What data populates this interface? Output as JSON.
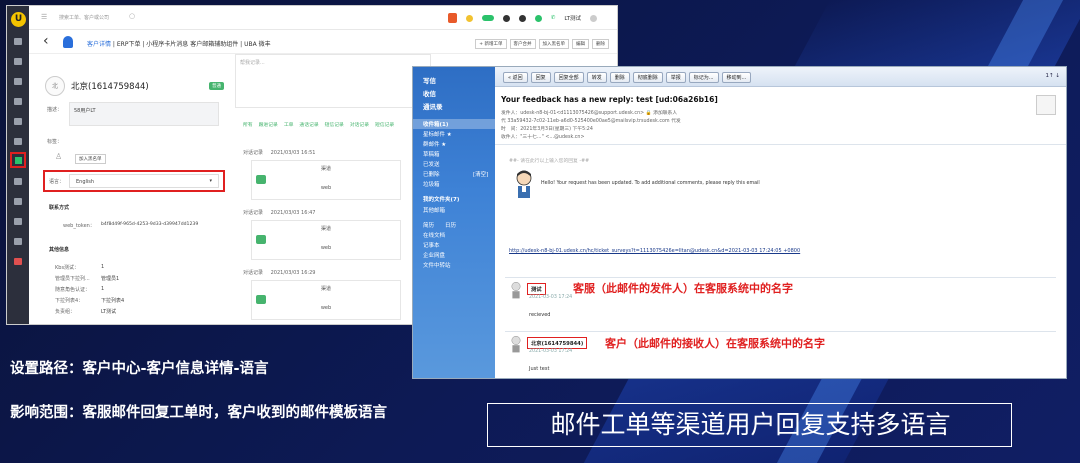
{
  "crm": {
    "search_placeholder": "搜索工单、客户或公司",
    "top_user": "LT测试",
    "head_tabs": [
      "客户详情",
      "ERP下单",
      "小程序卡片消息",
      "客户邮箱辅助组件",
      "UBA",
      "微丰"
    ],
    "head_buttons": [
      "+ 新增工单",
      "客户合并",
      "加入黑名单",
      "编辑",
      "删除"
    ],
    "customer_avatar_text": "北",
    "customer_name": "北京(1614759844)",
    "customer_tag": "普通",
    "desc_label": "描述：",
    "desc_value": "58用户LT",
    "tag_label": "标签：",
    "blacklist_btn": "加入黑名单",
    "lang_label": "语言：",
    "lang_value": "English",
    "contact_title": "联系方式",
    "web_token_label": "web_token：",
    "web_token_value": "b4f8d49f-965d-4253-9d33-d39947dd1239",
    "other_title": "其他信息",
    "other_rows": [
      {
        "label": "Kbs测试：",
        "value": "1"
      },
      {
        "label": "管理员下拉列...",
        "value": "管理员1"
      },
      {
        "label": "随意角色认证：",
        "value": "1"
      },
      {
        "label": "下拉列表4：",
        "value": "下拉列表4"
      },
      {
        "label": "负责组：",
        "value": "LT测试"
      }
    ],
    "comment_placeholder": "帮我记录...",
    "activity_tabs": [
      "所有",
      "跟进记录",
      "工单",
      "通话记录",
      "短信记录",
      "对话记录",
      "短信记录"
    ],
    "records": [
      {
        "type": "对话记录",
        "time": "2021/03/03 16:51",
        "title": "渠道",
        "channel": "web"
      },
      {
        "type": "对话记录",
        "time": "2021/03/03 16:47",
        "title": "渠道",
        "channel": "web"
      },
      {
        "type": "对话记录",
        "time": "2021/03/03 16:29",
        "title": "渠道",
        "channel": "web"
      }
    ]
  },
  "mail": {
    "sidebar": {
      "write": "写信",
      "inbox": "收信",
      "contacts": "通讯录",
      "folders": [
        "收件箱(1)",
        "星标邮件 ★",
        "群邮件 ★",
        "草稿箱",
        "已发送",
        "已删除",
        "垃圾箱"
      ],
      "deleted_count": "[清空]",
      "other_title": "我的文件夹(7)",
      "other_items": [
        "其他邮箱",
        "日历",
        "记事本",
        "企业网盘",
        "文件中转站"
      ],
      "misc": [
        "简历",
        "日历",
        "在线文档"
      ]
    },
    "toolbar": [
      "« 返回",
      "回复",
      "回复全部",
      "转发",
      "删除",
      "彻底删除",
      "举报",
      "标记为...",
      "移动到..."
    ],
    "page_indicator": "1↑ ↓",
    "subject": "Your feedback has a new reply: test [ud:06a26b16]",
    "from_line": "发件人：udesk-n8-bj-01<d1113075426@support.udesk.cn> 🔒 添加联系人",
    "code_line": "代 33a59432-7c02-11eb-a6d0-525400e00ae5@mailsvip.trsudesk.com 代发",
    "time_line": "时　间：2021年3月3日(星期三) 下午5:24",
    "to_line": "收件人：\"三十七…\" <…@udesk.cn>",
    "quote_hint": "##- 请在此行以上输入您的回复 -##",
    "reply_text": "Hello! Your request has been updated. To add additional comments, please reply this email",
    "link": "http://udesk-n8-bj-01.udesk.cn/hc/ticket_surveys?t=1113075426e=lltan@udesk.cn&d=2021-03-03 17:24:05 +0800",
    "msg1_sender": "测试",
    "msg1_time": "2021-03-03 17:24",
    "msg1_body": "recieved",
    "msg2_sender": "北京(1614759844)",
    "msg2_time": "2021-03-03 17:24",
    "msg2_body": "Just test",
    "anno1": "客服（此邮件的发件人）在客服系统中的名字",
    "anno2": "客户（此邮件的接收人）在客服系统中的名字"
  },
  "captions": {
    "path": "设置路径：客户中心-客户信息详情-语言",
    "scope": "影响范围：客服邮件回复工单时，客户收到的邮件模板语言",
    "headline": "邮件工单等渠道用户回复支持多语言"
  }
}
